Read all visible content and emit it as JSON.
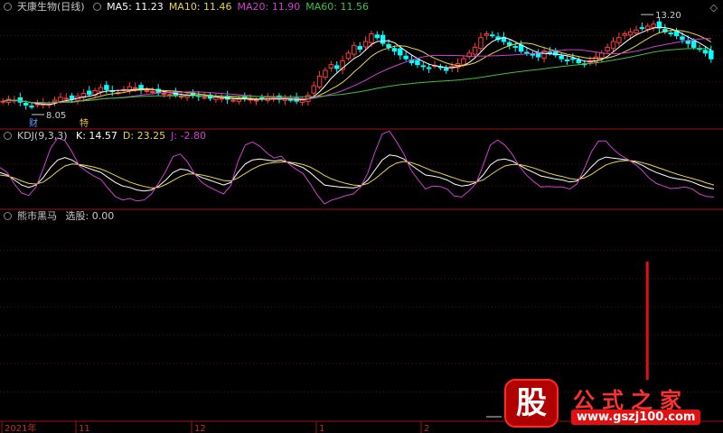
{
  "header": {
    "pane1": {
      "title": "天康生物(日线)",
      "ma": [
        {
          "label": "MA5: 11.23",
          "color": "#ffffff"
        },
        {
          "label": "MA10: 11.46",
          "color": "#e8d44d"
        },
        {
          "label": "MA20: 11.90",
          "color": "#d040d0"
        },
        {
          "label": "MA60: 11.56",
          "color": "#40c040"
        }
      ]
    },
    "pane2": {
      "title": "KDJ(9,3,3)",
      "k": "K: 14.57",
      "d": "D: 23.25",
      "j": "J: -2.80",
      "k_color": "#ffffff",
      "d_color": "#e8d44d",
      "j_color": "#d040d0"
    },
    "pane3": {
      "title": "熊市黑马",
      "value": "选股: 0.00"
    },
    "corner_icon": "diamond-icon"
  },
  "chart_data": [
    {
      "type": "candlestick",
      "title": "天康生物(日线)",
      "annotations": {
        "high": "13.20",
        "low": "8.05",
        "markers": [
          "财",
          "特"
        ]
      },
      "x_labels": [
        "2021年",
        "11",
        "12",
        "1",
        "2"
      ],
      "ylim": [
        7.6,
        13.6
      ],
      "series": [
        {
          "name": "MA5",
          "color": "#ffffff"
        },
        {
          "name": "MA10",
          "color": "#e8d44d"
        },
        {
          "name": "MA20",
          "color": "#d040d0"
        },
        {
          "name": "MA60",
          "color": "#40c040"
        }
      ],
      "up_color": "#ff3c3c",
      "down_color": "#00ffff",
      "closes": [
        9.0,
        9.1,
        9.05,
        8.95,
        8.8,
        8.7,
        8.85,
        8.9,
        8.85,
        9.05,
        9.2,
        9.15,
        9.1,
        9.25,
        9.4,
        9.35,
        9.55,
        9.7,
        9.6,
        9.5,
        9.45,
        9.6,
        9.75,
        9.7,
        9.6,
        9.55,
        9.5,
        9.45,
        9.4,
        9.35,
        9.3,
        9.25,
        9.3,
        9.35,
        9.25,
        9.2,
        9.15,
        9.2,
        9.15,
        9.1,
        9.05,
        9.1,
        9.15,
        9.1,
        9.05,
        9.1,
        9.2,
        9.15,
        9.1,
        9.15,
        9.05,
        9.0,
        9.05,
        9.3,
        9.8,
        10.3,
        10.6,
        10.9,
        10.7,
        11.1,
        11.5,
        11.9,
        11.7,
        12.1,
        12.5,
        12.3,
        12.0,
        11.8,
        11.6,
        11.4,
        11.2,
        11.0,
        10.9,
        10.8,
        10.7,
        10.85,
        10.75,
        10.6,
        10.8,
        10.95,
        11.2,
        11.5,
        11.8,
        12.3,
        12.5,
        12.4,
        12.2,
        12.1,
        11.9,
        11.8,
        11.6,
        11.5,
        11.4,
        11.3,
        11.6,
        11.5,
        11.4,
        11.2,
        11.1,
        11.2,
        11.0,
        10.9,
        11.1,
        11.3,
        11.5,
        11.8,
        12.1,
        12.3,
        12.5,
        12.6,
        12.7,
        12.8,
        12.9,
        13.0,
        12.8,
        12.6,
        12.5,
        12.4,
        12.2,
        12.0,
        11.8,
        11.7,
        11.5,
        11.2
      ]
    },
    {
      "type": "line",
      "title": "KDJ(9,3,3)",
      "ylim": [
        -15,
        115
      ],
      "series": [
        {
          "name": "K",
          "color": "#ffffff",
          "values": [
            55,
            50,
            40,
            30,
            25,
            30,
            45,
            65,
            80,
            85,
            80,
            70,
            65,
            60,
            55,
            45,
            35,
            28,
            25,
            20,
            18,
            20,
            28,
            40,
            55,
            62,
            60,
            52,
            45,
            40,
            35,
            30,
            35,
            55,
            72,
            80,
            82,
            80,
            78,
            80,
            75,
            70,
            65,
            55,
            42,
            30,
            28,
            26,
            25,
            24,
            28,
            40,
            60,
            80,
            90,
            88,
            82,
            70,
            60,
            50,
            48,
            45,
            40,
            32,
            28,
            30,
            35,
            50,
            70,
            80,
            82,
            78,
            70,
            62,
            55,
            48,
            45,
            42,
            40,
            36,
            38,
            50,
            66,
            80,
            86,
            84,
            82,
            80,
            76,
            70,
            62,
            55,
            50,
            45,
            42,
            40,
            36,
            30,
            25,
            22
          ]
        },
        {
          "name": "D",
          "color": "#e8d44d",
          "values": [
            50,
            48,
            44,
            38,
            33,
            32,
            36,
            46,
            58,
            68,
            72,
            71,
            69,
            66,
            62,
            56,
            49,
            42,
            36,
            31,
            27,
            24,
            25,
            31,
            39,
            47,
            52,
            52,
            50,
            47,
            43,
            39,
            38,
            44,
            53,
            62,
            69,
            73,
            75,
            76,
            76,
            74,
            71,
            66,
            58,
            49,
            42,
            37,
            33,
            30,
            29,
            33,
            42,
            54,
            66,
            74,
            77,
            75,
            70,
            64,
            58,
            54,
            49,
            44,
            39,
            36,
            36,
            40,
            50,
            60,
            68,
            71,
            71,
            68,
            64,
            59,
            54,
            50,
            47,
            43,
            41,
            44,
            51,
            61,
            70,
            75,
            78,
            79,
            78,
            75,
            71,
            66,
            61,
            56,
            51,
            47,
            43,
            39,
            34,
            30
          ]
        },
        {
          "name": "J",
          "color": "#d040d0",
          "values": [
            65,
            55,
            32,
            14,
            9,
            26,
            63,
            103,
            124,
            119,
            96,
            68,
            57,
            48,
            41,
            23,
            7,
            0,
            3,
            -2,
            0,
            12,
            34,
            58,
            87,
            92,
            76,
            52,
            35,
            26,
            19,
            12,
            29,
            77,
            110,
            116,
            108,
            94,
            84,
            88,
            73,
            62,
            53,
            33,
            10,
            -8,
            0,
            4,
            9,
            12,
            26,
            54,
            96,
            132,
            138,
            116,
            92,
            60,
            40,
            22,
            28,
            27,
            22,
            8,
            6,
            18,
            33,
            70,
            110,
            120,
            110,
            92,
            68,
            50,
            37,
            26,
            27,
            26,
            26,
            22,
            32,
            62,
            96,
            118,
            118,
            102,
            90,
            82,
            72,
            60,
            44,
            33,
            28,
            23,
            24,
            26,
            22,
            12,
            7,
            6
          ]
        }
      ]
    },
    {
      "type": "bar",
      "title": "熊市黑马",
      "ylim": [
        0,
        1
      ],
      "signals": [
        {
          "index": 88,
          "value": 1,
          "color": "#e01010"
        }
      ]
    }
  ],
  "watermark": {
    "glyph": "股",
    "name": "公式之家",
    "url": "www.gszj100.com"
  }
}
